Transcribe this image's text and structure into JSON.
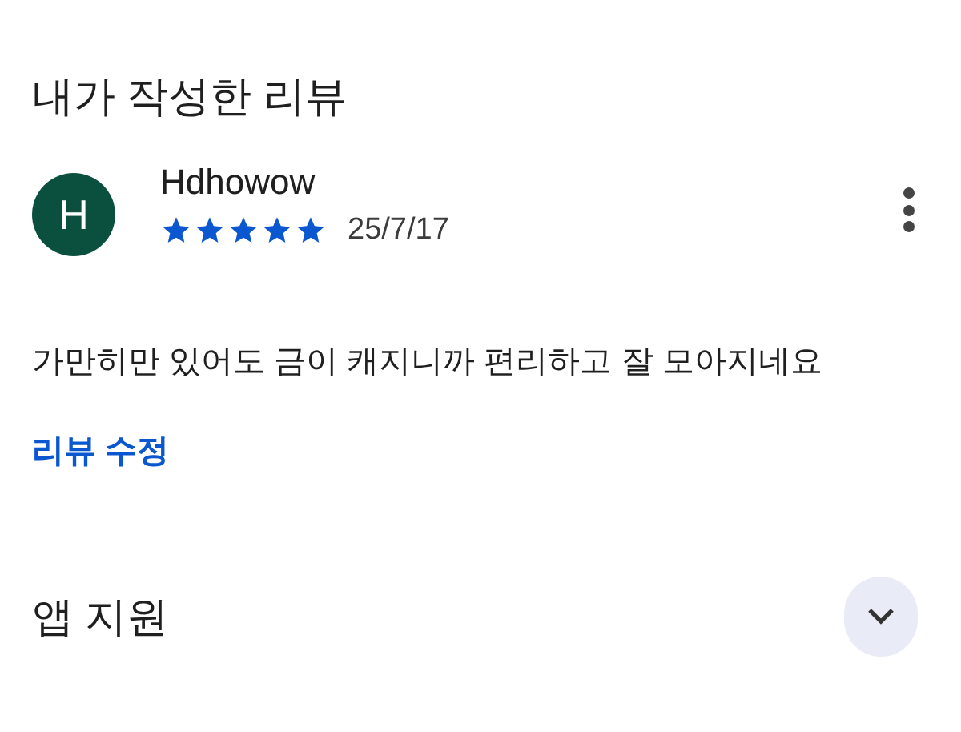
{
  "section_title": "내가 작성한 리뷰",
  "review": {
    "avatar_letter": "H",
    "author": "Hdhowow",
    "stars": 5,
    "date": "25/7/17",
    "text": "가만히만 있어도 금이 캐지니까 편리하고 잘 모아지네요",
    "edit_link": "리뷰 수정"
  },
  "support": {
    "title": "앱 지원",
    "expanded": false
  }
}
